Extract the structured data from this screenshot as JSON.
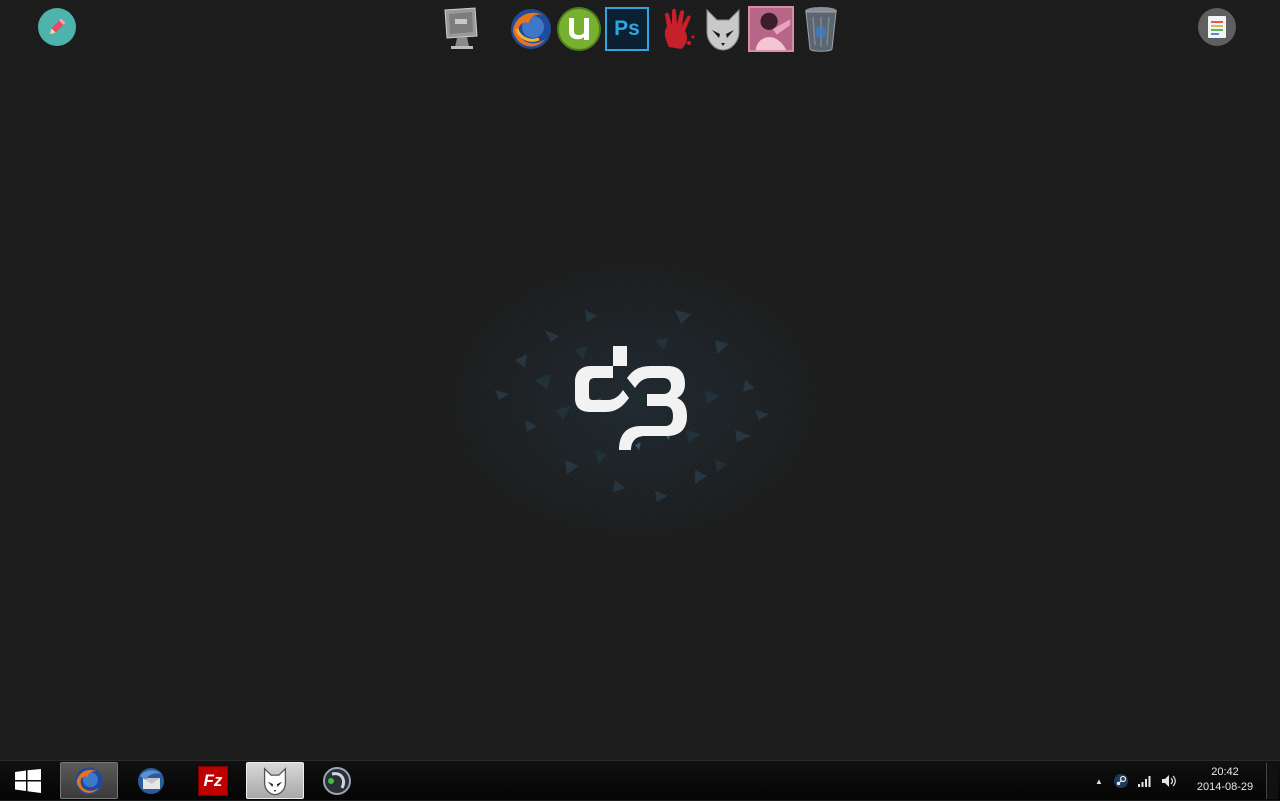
{
  "desktop": {
    "corner_left": {
      "icon": "pencil-icon",
      "color": "#4fb3ad"
    },
    "corner_right": {
      "icon": "notes-icon",
      "color": "#5f5f5f"
    },
    "wallpaper_logo": "db-logo",
    "dock": [
      {
        "name": "computer-icon"
      },
      {
        "name": "firefox-icon"
      },
      {
        "name": "utorrent-icon"
      },
      {
        "name": "photoshop-icon",
        "label": "Ps"
      },
      {
        "name": "bloody-hand-icon"
      },
      {
        "name": "foobar-icon"
      },
      {
        "name": "photo-thumbnail-icon"
      },
      {
        "name": "recycle-bin-icon"
      }
    ]
  },
  "taskbar": {
    "start": {
      "icon": "windows-logo-icon"
    },
    "buttons": [
      {
        "name": "firefox",
        "icon": "firefox-icon",
        "state": "active"
      },
      {
        "name": "thunderbird",
        "icon": "thunderbird-icon",
        "state": "normal"
      },
      {
        "name": "filezilla",
        "icon": "filezilla-icon",
        "label": "Fz",
        "state": "normal"
      },
      {
        "name": "foobar",
        "icon": "foobar-icon",
        "state": "pressed"
      },
      {
        "name": "teamspeak",
        "icon": "teamspeak-icon",
        "state": "normal"
      }
    ],
    "tray": {
      "overflow_arrow": "▲",
      "icons": [
        "steam-icon",
        "network-signal-icon",
        "volume-icon"
      ]
    },
    "clock": {
      "time": "20:42",
      "date": "2014-08-29"
    }
  }
}
